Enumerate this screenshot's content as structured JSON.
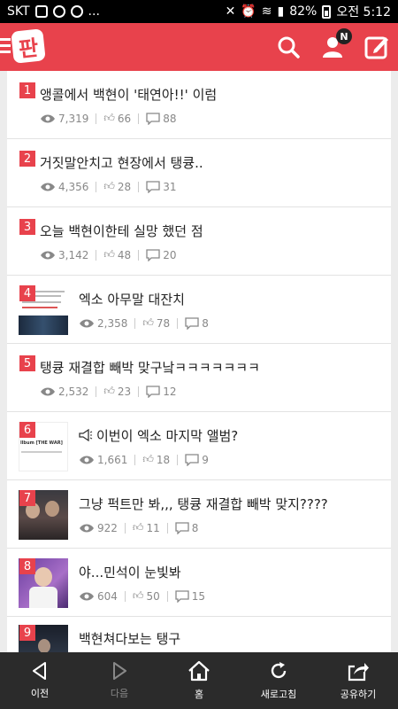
{
  "status": {
    "carrier": "SKT",
    "battery": "82%",
    "time": "오전 5:12"
  },
  "posts": [
    {
      "rank": "1",
      "title": "앵콜에서 백현이 '태연아!!' 이럼",
      "views": "7,319",
      "likes": "66",
      "comments": "88"
    },
    {
      "rank": "2",
      "title": "거짓말안치고 현장에서 탱큥..",
      "views": "4,356",
      "likes": "28",
      "comments": "31"
    },
    {
      "rank": "3",
      "title": "오늘 백현이한테 실망 했던 점",
      "views": "3,142",
      "likes": "48",
      "comments": "20"
    },
    {
      "rank": "4",
      "title": "엑소 아무말 대잔치",
      "views": "2,358",
      "likes": "78",
      "comments": "8"
    },
    {
      "rank": "5",
      "title": "탱큥 재결합 빼박 맞구낰ㅋㅋㅋㅋㅋㅋㅋ",
      "views": "2,532",
      "likes": "23",
      "comments": "12"
    },
    {
      "rank": "6",
      "title": "이번이 엑소 마지막 앨범?",
      "views": "1,661",
      "likes": "18",
      "comments": "9",
      "thumb_text": "llbum [THE WAR]"
    },
    {
      "rank": "7",
      "title": "그냥 퍽트만 봐,,, 탱큥 재결합 빼박 맞지????",
      "views": "922",
      "likes": "11",
      "comments": "8"
    },
    {
      "rank": "8",
      "title": "야...민석이 눈빛봐",
      "views": "604",
      "likes": "50",
      "comments": "15"
    },
    {
      "rank": "9",
      "title": "백현쳐다보는 탱구"
    }
  ],
  "nav": {
    "prev": "이전",
    "next": "다음",
    "home": "홈",
    "refresh": "새로고침",
    "share": "공유하기"
  },
  "logo": "판",
  "notification_badge": "N",
  "colors": {
    "accent": "#e8424c"
  }
}
